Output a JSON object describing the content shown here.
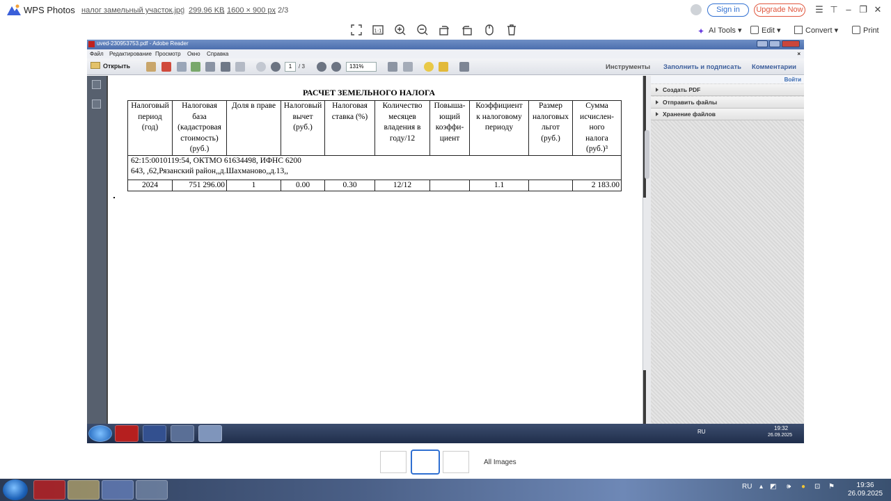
{
  "wps": {
    "app_name": "WPS Photos",
    "file_name": "налог замельный участок.jpg",
    "file_size": "299.96 KB",
    "dimensions": "1600 × 900 px",
    "position": "2/3",
    "sign_in": "Sign in",
    "upgrade": "Upgrade Now",
    "toolbar_right": {
      "ai_tools": "AI Tools",
      "edit": "Edit",
      "convert": "Convert",
      "print": "Print"
    },
    "all_images": "All Images"
  },
  "reader": {
    "window_title": "uved-230953753.pdf - Adobe Reader",
    "menu": [
      "Файл",
      "Редактирование",
      "Просмотр",
      "Окно",
      "Справка"
    ],
    "open_label": "Открыть",
    "page_current": "1",
    "page_total": "/ 3",
    "zoom": "131%",
    "right_tabs": [
      "Инструменты",
      "Заполнить и подписать",
      "Комментарии"
    ],
    "login": "Войти",
    "panel_sections": [
      "Создать PDF",
      "Отправить файлы",
      "Хранение файлов"
    ],
    "taskbar_lang": "RU",
    "taskbar_time": "19:32",
    "taskbar_date": "26.09.2025"
  },
  "document": {
    "title": "РАСЧЕТ ЗЕМЕЛЬНОГО НАЛОГА",
    "headers": [
      [
        "Налоговый",
        "период",
        "(год)"
      ],
      [
        "Налоговая",
        "база",
        "(кадастровая",
        "стоимость)",
        "(руб.)"
      ],
      [
        "Доля в праве"
      ],
      [
        "Налоговый",
        "вычет",
        "(руб.)"
      ],
      [
        "Налоговая",
        "ставка (%)"
      ],
      [
        "Количество",
        "месяцев",
        "владения в",
        "году/12"
      ],
      [
        "Повыша-",
        "ющий",
        "коэффи-",
        "циент"
      ],
      [
        "Коэффициент",
        "к налоговому",
        "периоду"
      ],
      [
        "Размер",
        "налоговых",
        "льгот",
        "(руб.)"
      ],
      [
        "Сумма",
        "исчислен-",
        "ного",
        "налога",
        "(руб.)³"
      ]
    ],
    "address_line1": "62:15:0010119:54, ОКТМО 61634498, ИФНС 6200",
    "address_line2": "643, ,62,Рязанский район,,д.Шахманово,,д.13,,",
    "row": [
      "2024",
      "751 296.00",
      "1",
      "0.00",
      "0.30",
      "12/12",
      "",
      "1.1",
      "",
      "2 183.00"
    ]
  },
  "windows": {
    "lang": "RU",
    "time": "19:36",
    "date": "26.09.2025"
  }
}
